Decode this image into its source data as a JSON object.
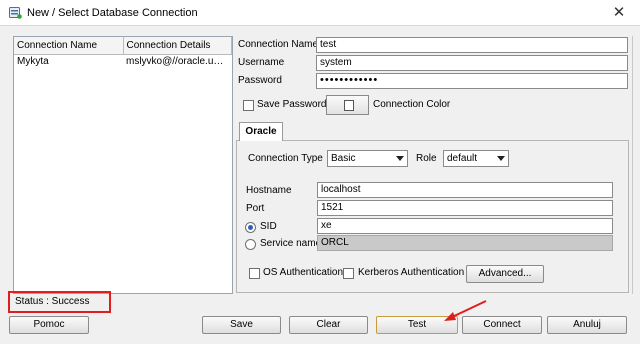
{
  "window": {
    "title": "New / Select Database Connection",
    "close_glyph": "✕"
  },
  "connections": {
    "headers": [
      "Connection Name",
      "Connection Details"
    ],
    "rows": [
      {
        "name": "Mykyta",
        "details": "mslyvko@//oracle.umc..."
      }
    ]
  },
  "form": {
    "connection_name_label": "Connection Name",
    "connection_name_value": "test",
    "username_label": "Username",
    "username_value": "system",
    "password_label": "Password",
    "password_value": "••••••••••••",
    "save_password_label": "Save Password",
    "save_password_checked": false,
    "connection_color_label": "Connection Color"
  },
  "tab": {
    "label": "Oracle",
    "connection_type_label": "Connection Type",
    "connection_type_value": "Basic",
    "role_label": "Role",
    "role_value": "default",
    "hostname_label": "Hostname",
    "hostname_value": "localhost",
    "port_label": "Port",
    "port_value": "1521",
    "sid_label": "SID",
    "sid_value": "xe",
    "sid_selected": true,
    "service_name_label": "Service name",
    "service_name_value": "ORCL",
    "os_auth_label": "OS Authentication",
    "kerberos_auth_label": "Kerberos Authentication",
    "advanced_label": "Advanced..."
  },
  "status": {
    "text": "Status : Success",
    "highlight_color": "#e01e1e"
  },
  "buttons": {
    "help": "Pomoc",
    "save": "Save",
    "clear": "Clear",
    "test": "Test",
    "connect": "Connect",
    "cancel": "Anuluj"
  },
  "icons": {
    "app": "database-connection-icon",
    "annotation": "red-arrow-icon"
  }
}
